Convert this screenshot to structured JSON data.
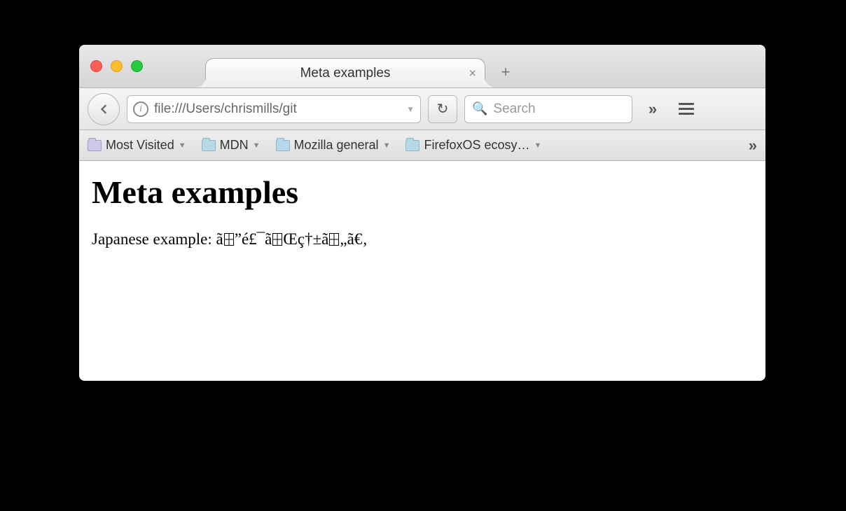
{
  "tab": {
    "title": "Meta examples"
  },
  "toolbar": {
    "url": "file:///Users/chrismills/git",
    "search_placeholder": "Search"
  },
  "bookmarks": {
    "items": [
      {
        "label": "Most Visited"
      },
      {
        "label": "MDN"
      },
      {
        "label": "Mozilla general"
      },
      {
        "label": "FirefoxOS ecosy…"
      }
    ]
  },
  "page": {
    "heading": "Meta examples",
    "body_prefix": "Japanese example: ",
    "garbled_parts": [
      "ã",
      "”é£¯ã",
      "Œç†±ã",
      "„ã€‚"
    ]
  }
}
